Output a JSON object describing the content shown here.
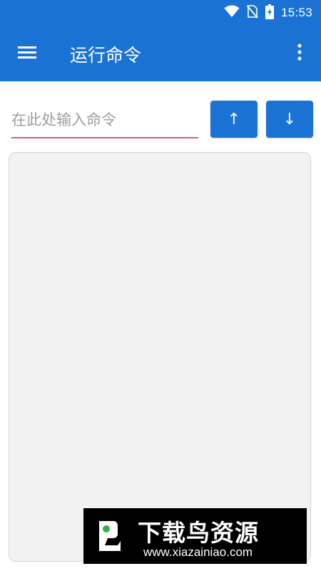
{
  "status_bar": {
    "time": "15:53",
    "icons": [
      "wifi-icon",
      "no-sim-icon",
      "battery-charging-icon"
    ]
  },
  "app_bar": {
    "title": "运行命令",
    "menu_icon": "menu-icon",
    "overflow_icon": "more-vert-icon"
  },
  "command": {
    "placeholder": "在此处输入命令",
    "value": ""
  },
  "history_buttons": {
    "up_label": "↑",
    "down_label": "↓"
  },
  "output": {
    "text": ""
  },
  "watermark": {
    "title": "下载鸟资源",
    "url": "www.xiazainiao.com"
  },
  "colors": {
    "primary": "#1a73d4",
    "input_underline": "#d6607f",
    "output_bg": "#f2f2f2"
  }
}
